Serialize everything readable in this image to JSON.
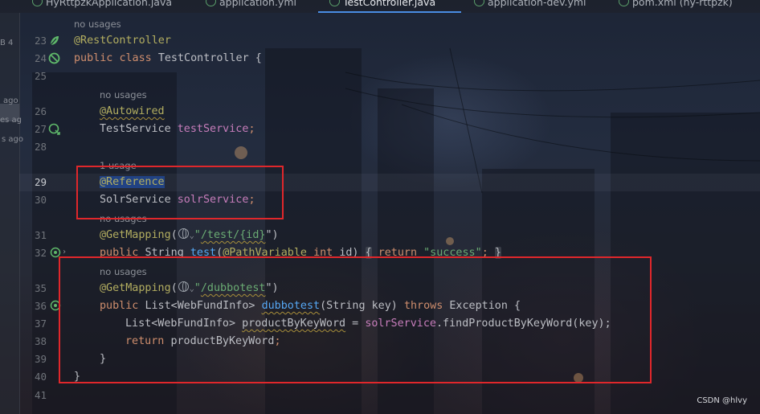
{
  "tabs": [
    {
      "label": "HyRttpzkApplication.java",
      "active": false
    },
    {
      "label": "application.yml",
      "active": false
    },
    {
      "label": "TestController.java",
      "active": true
    },
    {
      "label": "application-dev.yml",
      "active": false
    },
    {
      "label": "pom.xml (hy-rttpzk)",
      "active": false
    }
  ],
  "tool_strip": {
    "items": [
      "B 4",
      "ago",
      "es ag",
      "s ago"
    ]
  },
  "editor": {
    "hints": {
      "top": "no usages",
      "autowired": "no usages",
      "reference": "1 usage",
      "getmapping_test": "no usages",
      "dubbotest": "no usages"
    },
    "line_numbers": [
      "23",
      "24",
      "25",
      "26",
      "27",
      "28",
      "29",
      "30",
      "31",
      "32",
      "35",
      "36",
      "37",
      "38",
      "39",
      "40",
      "41"
    ],
    "tokens": {
      "rest_controller": "@RestController",
      "public": "public",
      "class": "class",
      "class_name": "TestController {",
      "autowired": "@Autowired",
      "test_service_type": "TestService",
      "test_service_field": "testService",
      "semicolon": ";",
      "reference": "@Reference",
      "solr_service_type": "SolrService",
      "solr_service_field": "solrService",
      "get_mapping": "@GetMapping",
      "paren_open": "(",
      "quote_open": "\"",
      "path_test": "/test/{id}",
      "paren_close_quote": "\")",
      "string_type": "String",
      "test_method": "test",
      "path_variable": "@PathVariable",
      "int": "int",
      "id_param": "id)",
      "brace_open": "{",
      "return": "return",
      "success_str": "\"success\"",
      "brace_close": "}",
      "path_dubbo": "/dubbotest",
      "list_type": "List<WebFundInfo>",
      "dubbotest_method": "dubbotest",
      "params": "(String key)",
      "throws": "throws",
      "exception": "Exception {",
      "local_var": "productByKeyWord",
      "assign": " = ",
      "call": ".findProductByKeyWord(key);",
      "return_value": "productByKeyWord",
      "close_method": "}",
      "close_class": "}"
    }
  },
  "watermark": "CSDN @hlvy",
  "colors": {
    "keyword": "#cf8e6d",
    "annotation": "#b3ae60",
    "string": "#6aab73",
    "field": "#c77dbb",
    "method": "#56a8f5",
    "highlight_box": "#e0272b"
  }
}
